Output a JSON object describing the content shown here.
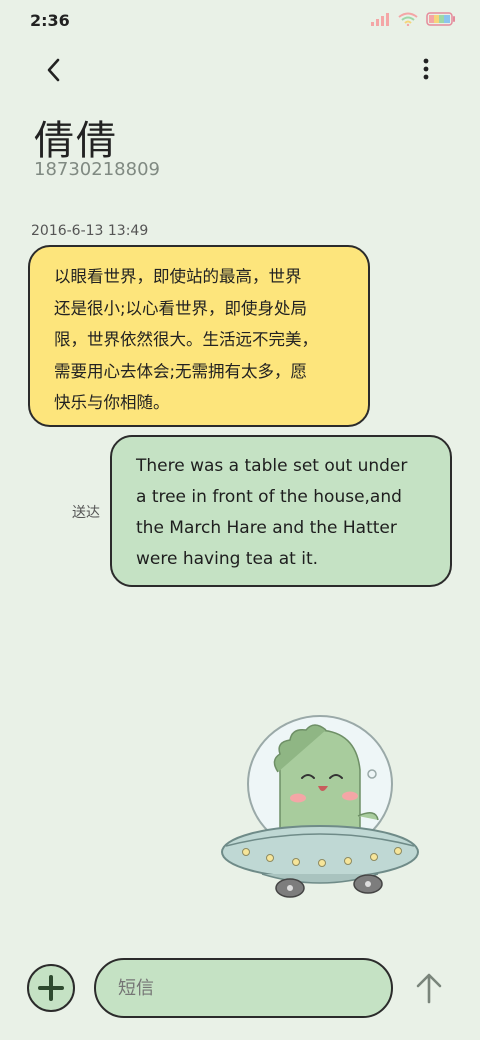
{
  "status_bar": {
    "time": "2:36",
    "icons": [
      "signal-icon",
      "wifi-icon",
      "battery-icon"
    ]
  },
  "header": {
    "back_icon": "chevron-left-icon",
    "menu_icon": "more-vertical-icon"
  },
  "contact": {
    "name": "倩倩",
    "number": "18730218809"
  },
  "conversation": {
    "timestamp": "2016-6-13 13:49",
    "incoming": {
      "lines": [
        "以眼看世界，即使站的最高，世界",
        "还是很小;以心看世界，即使身处局",
        "限，世界依然很大。生活远不完美，",
        "需要用心去体会;无需拥有太多，愿",
        "快乐与你相随。"
      ]
    },
    "outgoing": {
      "status": "送达",
      "lines": [
        "There was a table set out under",
        "a tree in front of the house,and",
        "the March Hare and the Hatter",
        "were having tea at it."
      ]
    }
  },
  "composer": {
    "placeholder": "短信",
    "add_icon": "plus-icon",
    "send_icon": "arrow-up-icon"
  },
  "colors": {
    "background": "#e9f1e7",
    "incoming_bubble": "#fde57c",
    "outgoing_bubble": "#c5e2c4",
    "border": "#2b2b2b"
  }
}
